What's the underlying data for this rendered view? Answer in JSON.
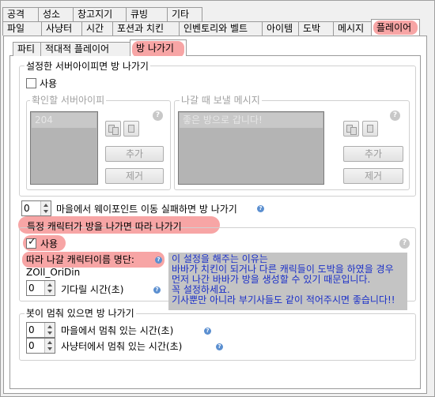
{
  "main_tabs_row1": [
    "공격",
    "성소",
    "창고지기",
    "큐빙",
    "기타"
  ],
  "main_tabs_row2": [
    "파일",
    "사냥터",
    "시간",
    "포션과 치킨",
    "인벤토리와 벨트",
    "아이템",
    "도박",
    "메시지",
    "플레이어"
  ],
  "sub_tabs": [
    "파티",
    "적대적 플레이어",
    "방 나가기"
  ],
  "server_leave": {
    "title": "설정한 서버아이피면 방 나가기",
    "use_label": "사용",
    "ip_group_title": "확인할 서버아이피",
    "ip_list_selected": "204",
    "msg_group_title": "나갈 때 보낼 메시지",
    "msg_list_selected": "좋은 방으로 갑니다!",
    "add_label": "추가",
    "remove_label": "제거",
    "help_symbol": "?"
  },
  "waypoint": {
    "value": "0",
    "label": "마을에서 웨이포인트 이동 실패하면 방 나가기"
  },
  "follow_leave": {
    "title": "특정 캐릭터가 방을 나가면 따라 나가기",
    "use_label": "사용",
    "char_label": "따라 나갈 캐릭터이름 명단:",
    "char_value": "ZOll_OriDin",
    "wait_value": "0",
    "wait_label": "기다릴 시간(초)",
    "help_symbol": "?"
  },
  "note_lines": [
    "이 설정을 해주는 이유는",
    "바바가 치킨이 되거나 다른 캐릭들이 도박을 하였을 경우",
    "먼저 나간 바바가 방을 생성할 수 있기 때문입니다.",
    "꼭 설정하세요.",
    "기사뿐만 아니라 부기사들도 같이 적어주시면 좋습니다!!"
  ],
  "bot_stuck": {
    "title": "봇이 멈춰 있으면 방 나가기",
    "town_value": "0",
    "town_label": "마을에서 멈춰 있는 시간(초)",
    "field_value": "0",
    "field_label": "사냥터에서 멈춰 있는 시간(초)"
  },
  "colors": {
    "highlight": "#f7a5a5",
    "note_text": "#1a2fc8",
    "note_bg": "#c4c4c4"
  }
}
